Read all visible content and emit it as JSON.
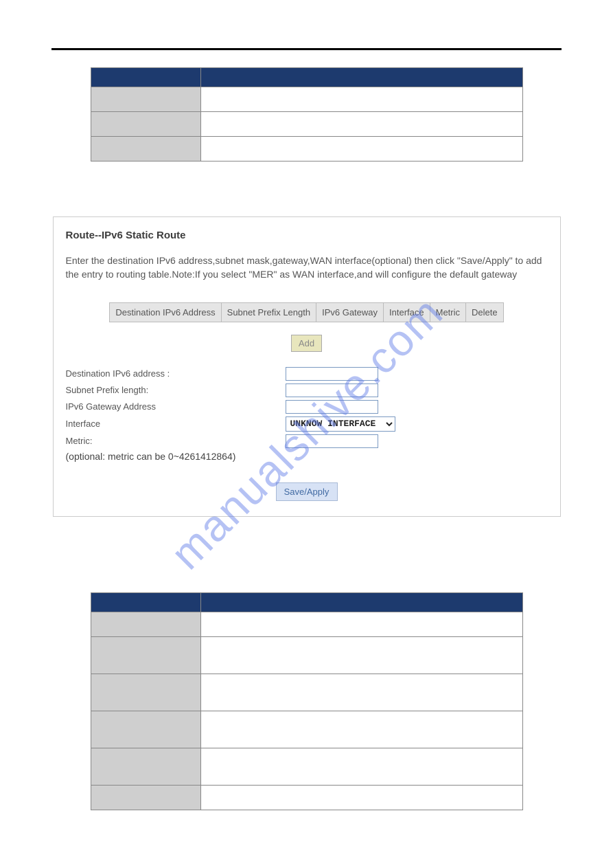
{
  "watermark": "manualshive.com",
  "table1": {
    "field_header": "",
    "desc_header": "",
    "rows": [
      {
        "field": "",
        "desc": ""
      },
      {
        "field": "",
        "desc": ""
      },
      {
        "field": "",
        "desc": ""
      }
    ]
  },
  "route_panel": {
    "title": "Route--IPv6 Static Route",
    "description": "Enter the destination IPv6 address,subnet mask,gateway,WAN interface(optional) then click \"Save/Apply\" to add the entry to routing table.Note:If you select \"MER\" as WAN interface,and will configure the default gateway",
    "headers": {
      "dest": "Destination IPv6 Address",
      "prefix": "Subnet Prefix Length",
      "gateway": "IPv6 Gateway",
      "interface": "Interface",
      "metric": "Metric",
      "delete": "Delete"
    },
    "add_label": "Add",
    "form": {
      "dest_label": "Destination IPv6 address :",
      "dest_value": "",
      "prefix_label": "Subnet Prefix length:",
      "prefix_value": "",
      "gateway_label": "IPv6 Gateway Address",
      "gateway_value": "",
      "interface_label": "Interface",
      "interface_value": "UNKNOW INTERFACE",
      "metric_label": "Metric:",
      "metric_value": "",
      "optional_note": "(optional: metric can be 0~4261412864)",
      "save_label": "Save/Apply"
    }
  },
  "table2": {
    "field_header": "",
    "desc_header": "",
    "rows": [
      {
        "field": "",
        "desc": ""
      },
      {
        "field": "",
        "desc": ""
      },
      {
        "field": "",
        "desc": ""
      },
      {
        "field": "",
        "desc": ""
      },
      {
        "field": "",
        "desc": ""
      },
      {
        "field": "",
        "desc": ""
      }
    ]
  }
}
